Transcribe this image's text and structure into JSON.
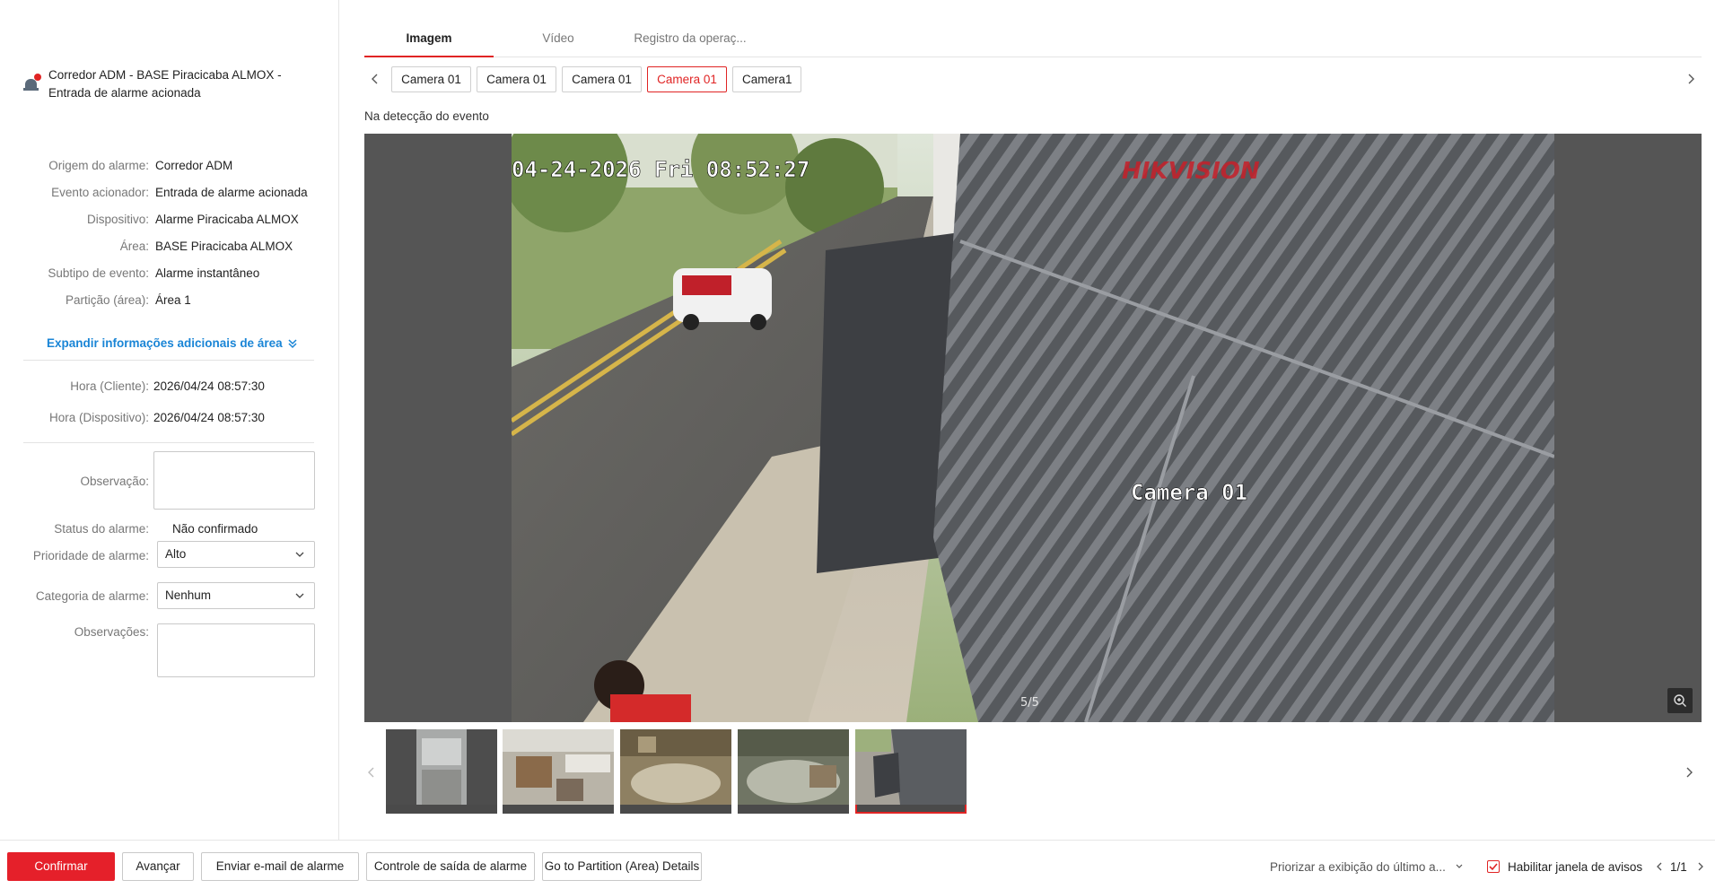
{
  "alarm": {
    "title_line1": "Corredor ADM - BASE Piracicaba ALMOX -",
    "title_line2": "Entrada de alarme acionada",
    "icon": "alarm-bell-icon"
  },
  "details": [
    {
      "label": "Origem do alarme:",
      "value": "Corredor ADM"
    },
    {
      "label": "Evento acionador:",
      "value": "Entrada de alarme acionada"
    },
    {
      "label": "Dispositivo:",
      "value": "Alarme Piracicaba ALMOX"
    },
    {
      "label": "Área:",
      "value": "BASE Piracicaba ALMOX"
    },
    {
      "label": "Subtipo de evento:",
      "value": "Alarme instantâneo"
    },
    {
      "label": "Partição (área):",
      "value": "Área 1"
    }
  ],
  "expand_label": "Expandir informações adicionais de área",
  "times": [
    {
      "label": "Hora (Cliente):",
      "value": "2026/04/24 08:57:30"
    },
    {
      "label": "Hora (Dispositivo):",
      "value": "2026/04/24 08:57:30"
    }
  ],
  "form": {
    "observacao_label": "Observação:",
    "status_label": "Status do alarme:",
    "status_value": "Não confirmado",
    "priority_label": "Prioridade de alarme:",
    "priority_value": "Alto",
    "category_label": "Categoria de alarme:",
    "category_value": "Nenhum",
    "observacoes_label": "Observações:"
  },
  "tabs": [
    "Imagem",
    "Vídeo",
    "Registro da operaç..."
  ],
  "cameras": [
    "Camera 01",
    "Camera 01",
    "Camera 01",
    "Camera 01",
    "Camera1"
  ],
  "event_label": "Na detecção do evento",
  "viewer": {
    "osd_datetime": "04-24-2026 Fri 08:52:27",
    "osd_brand": "HIKVISION",
    "osd_camera": "Camera 01",
    "counter": "5/5"
  },
  "buttons": {
    "confirm": "Confirmar",
    "advance": "Avançar",
    "email": "Enviar e-mail de alarme",
    "output": "Controle de saída de alarme",
    "partition": "Go to Partition (Area) Details"
  },
  "bottom": {
    "prioritize": "Priorizar a exibição do último a...",
    "enable_popup": "Habilitar janela de avisos",
    "pager": "1/1"
  },
  "colors": {
    "accent": "#e02424",
    "link": "#1a85d6"
  }
}
